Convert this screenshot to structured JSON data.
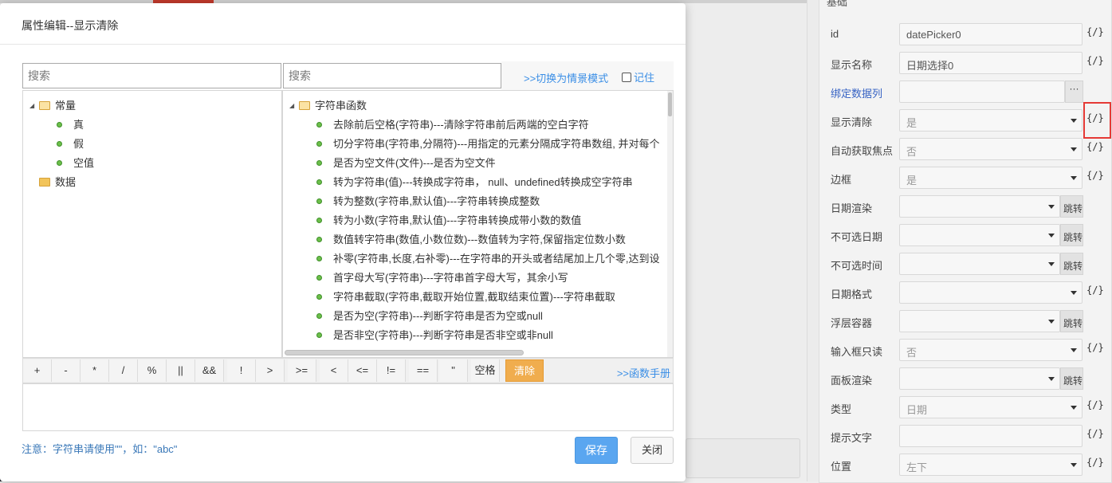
{
  "dialog": {
    "title": "属性编辑--显示清除",
    "search_left_placeholder": "搜索",
    "search_right_placeholder": "搜索",
    "switch_link": ">>切换为情景模式",
    "remember_label": "记住",
    "manual_link": ">>函数手册",
    "note": "注意：字符串请使用\"\"，如：\"abc\"",
    "save_label": "保存",
    "close_label": "关闭"
  },
  "left_tree": {
    "group1": "常量",
    "items": [
      "真",
      "假",
      "空值"
    ],
    "group2": "数据"
  },
  "right_tree": {
    "group": "字符串函数",
    "items": [
      "去除前后空格(字符串)---清除字符串前后两端的空白字符",
      "切分字符串(字符串,分隔符)---用指定的元素分隔成字符串数组, 并对每个",
      "是否为空文件(文件)---是否为空文件",
      "转为字符串(值)---转换成字符串，  null、undefined转换成空字符串",
      "转为整数(字符串,默认值)---字符串转换成整数",
      "转为小数(字符串,默认值)---字符串转换成带小数的数值",
      "数值转字符串(数值,小数位数)---数值转为字符,保留指定位数小数",
      "补零(字符串,长度,右补零)---在字符串的开头或者结尾加上几个零,达到设",
      "首字母大写(字符串)---字符串首字母大写，其余小写",
      "字符串截取(字符串,截取开始位置,截取结束位置)---字符串截取",
      "是否为空(字符串)---判断字符串是否为空或null",
      "是否非空(字符串)---判断字符串是否非空或非null"
    ]
  },
  "operators": [
    "+",
    "-",
    "*",
    "/",
    "%",
    "||",
    "&&",
    "!",
    ">",
    ">=",
    "<",
    "<=",
    "!=",
    "==",
    "\"",
    "空格",
    "清除"
  ],
  "right_panel": {
    "section_title": "基础",
    "expr_icon": "{/}",
    "jump_label": "跳转",
    "more_label": "···",
    "props": [
      {
        "label": "id",
        "value": "datePicker0"
      },
      {
        "label": "显示名称",
        "value": "日期选择0"
      },
      {
        "label": "绑定数据列",
        "value": ""
      },
      {
        "label": "显示清除",
        "value": "是"
      },
      {
        "label": "自动获取焦点",
        "value": "否"
      },
      {
        "label": "边框",
        "value": "是"
      },
      {
        "label": "日期渲染",
        "value": ""
      },
      {
        "label": "不可选日期",
        "value": ""
      },
      {
        "label": "不可选时间",
        "value": ""
      },
      {
        "label": "日期格式",
        "value": ""
      },
      {
        "label": "浮层容器",
        "value": ""
      },
      {
        "label": "输入框只读",
        "value": "否"
      },
      {
        "label": "面板渲染",
        "value": ""
      },
      {
        "label": "类型",
        "value": "日期"
      },
      {
        "label": "提示文字",
        "value": ""
      },
      {
        "label": "位置",
        "value": "左下"
      }
    ]
  }
}
